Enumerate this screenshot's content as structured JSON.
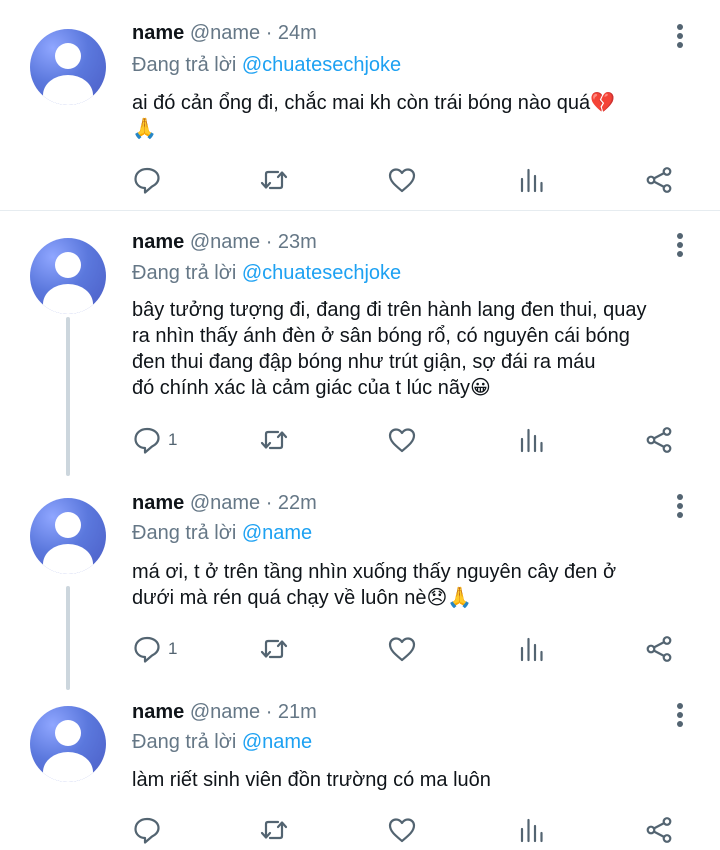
{
  "tweets": [
    {
      "name": "name",
      "handle": "@name",
      "time": "· 24m",
      "reply_prefix": "Đang trả lời",
      "reply_to": "@chuatesechjoke",
      "text_lines": [
        "ai đó cản ổng đi, chắc mai kh còn trái bóng nào quá💔",
        "🙏"
      ],
      "reply_count": ""
    },
    {
      "name": "name",
      "handle": "@name",
      "time": "· 23m",
      "reply_prefix": "Đang trả lời",
      "reply_to": "@chuatesechjoke",
      "text_lines": [
        "bây tưởng tượng đi, đang đi trên hành lang đen thui, quay",
        "ra nhìn thấy ánh đèn ở sân bóng rổ, có nguyên cái bóng",
        "đen thui đang đập bóng như trút giận, sợ đái ra máu",
        "đó chính xác là cảm giác của t lúc nãy😀"
      ],
      "reply_count": "1"
    },
    {
      "name": "name",
      "handle": "@name",
      "time": "· 22m",
      "reply_prefix": "Đang trả lời",
      "reply_to": "@name",
      "text_lines": [
        "má ơi, t ở trên tầng nhìn xuống thấy nguyên cây đen ở",
        "dưới mà rén quá chạy về luôn nè😞🙏"
      ],
      "reply_count": "1"
    },
    {
      "name": "name",
      "handle": "@name",
      "time": "· 21m",
      "reply_prefix": "Đang trả lời",
      "reply_to": "@name",
      "text_lines": [
        "làm riết sinh viên đồn trường có ma luôn"
      ],
      "reply_count": ""
    }
  ],
  "icons": {
    "more": "more-vertical-icon",
    "reply": "reply-bubble-icon",
    "retweet": "retweet-icon",
    "like": "heart-icon",
    "stats": "stats-bars-icon",
    "share": "share-icon"
  },
  "colors": {
    "mention": "#1da1f2",
    "secondary_text": "#657786",
    "avatar": "#5b78dd",
    "thread_line": "#ccd6dd"
  }
}
